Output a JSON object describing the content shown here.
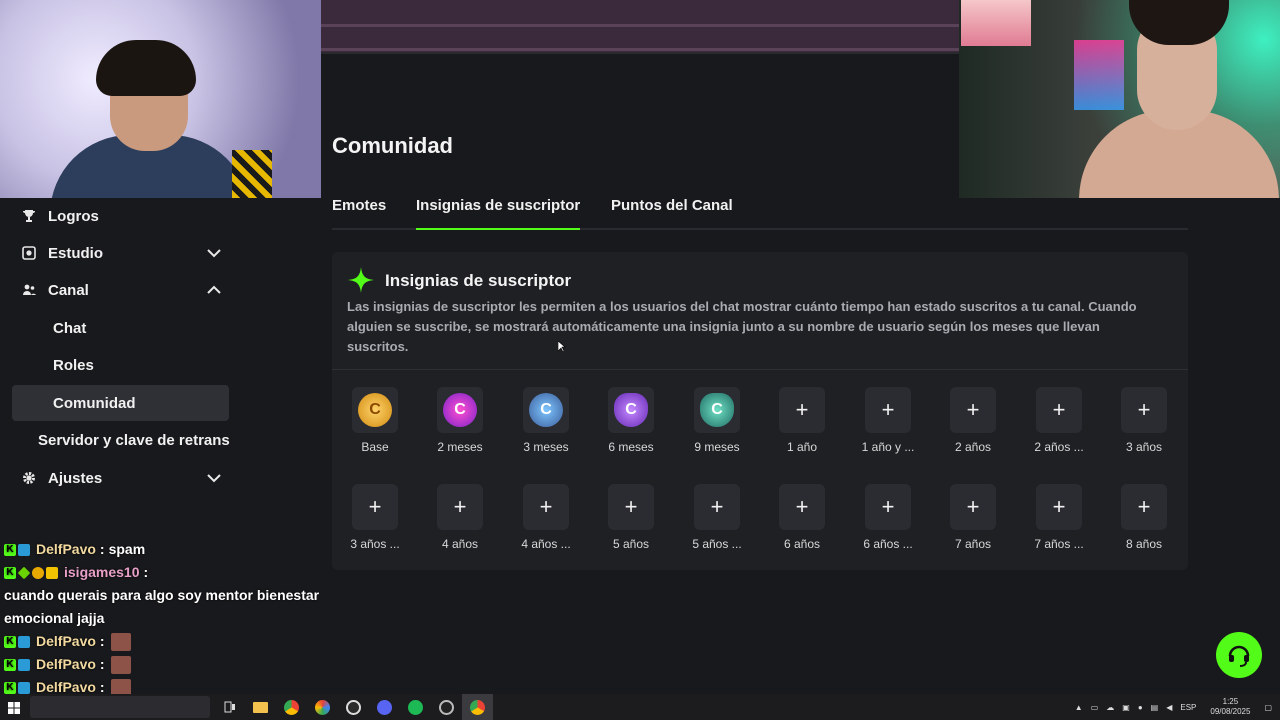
{
  "sidebar": {
    "items": [
      {
        "label": "Logros",
        "icon": "trophy-icon"
      },
      {
        "label": "Estudio",
        "icon": "studio-icon",
        "chevron": "down"
      },
      {
        "label": "Canal",
        "icon": "channel-icon",
        "chevron": "up"
      },
      {
        "label": "Chat"
      },
      {
        "label": "Roles"
      },
      {
        "label": "Comunidad"
      },
      {
        "label": "Servidor y clave de retrans"
      },
      {
        "label": "Ajustes",
        "icon": "gear-icon",
        "chevron": "down"
      }
    ]
  },
  "chat": {
    "messages": [
      {
        "user": "DelfPavo",
        "sep": ":",
        "text": "spam"
      },
      {
        "user": "isigames10",
        "sep": ":",
        "text": "cuando querais para algo soy mentor bienestar emocional jajja"
      },
      {
        "user": "DelfPavo",
        "sep": ":",
        "text": ""
      },
      {
        "user": "DelfPavo",
        "sep": ":",
        "text": ""
      },
      {
        "user": "DelfPavo",
        "sep": ":",
        "text": ""
      }
    ]
  },
  "page": {
    "title": "Comunidad",
    "tabs": [
      {
        "label": "Emotes",
        "active": false
      },
      {
        "label": "Insignias de suscriptor",
        "active": true
      },
      {
        "label": "Puntos del Canal",
        "active": false
      }
    ]
  },
  "card": {
    "title": "Insignias de suscriptor",
    "description": "Las insignias de suscriptor les permiten a los usuarios del chat mostrar cuánto tiempo han estado suscritos a tu canal. Cuando alguien se suscribe, se mostrará automáticamente una insignia junto a su nombre de usuario según los meses que llevan suscritos.",
    "badges_row1": [
      {
        "label": "Base",
        "type": "medal",
        "style": "m-base",
        "glyph": "C"
      },
      {
        "label": "2 meses",
        "type": "medal",
        "style": "m-2",
        "glyph": "C"
      },
      {
        "label": "3 meses",
        "type": "medal",
        "style": "m-3",
        "glyph": "C"
      },
      {
        "label": "6 meses",
        "type": "medal",
        "style": "m-6",
        "glyph": "C"
      },
      {
        "label": "9 meses",
        "type": "medal",
        "style": "m-9",
        "glyph": "C"
      },
      {
        "label": "1 año",
        "type": "add"
      },
      {
        "label": "1 año y ...",
        "type": "add"
      },
      {
        "label": "2 años",
        "type": "add"
      },
      {
        "label": "2 años ...",
        "type": "add"
      },
      {
        "label": "3 años",
        "type": "add"
      }
    ],
    "badges_row2": [
      {
        "label": "3 años ...",
        "type": "add"
      },
      {
        "label": "4 años",
        "type": "add"
      },
      {
        "label": "4 años ...",
        "type": "add"
      },
      {
        "label": "5 años",
        "type": "add"
      },
      {
        "label": "5 años ...",
        "type": "add"
      },
      {
        "label": "6 años",
        "type": "add"
      },
      {
        "label": "6 años ...",
        "type": "add"
      },
      {
        "label": "7 años",
        "type": "add"
      },
      {
        "label": "7 años ...",
        "type": "add"
      },
      {
        "label": "8 años",
        "type": "add"
      }
    ],
    "add_glyph": "+"
  },
  "taskbar": {
    "tray_lang": "ESP",
    "time": "1:25",
    "date": "09/08/2025"
  },
  "colors": {
    "accent": "#53fc18",
    "background": "#18191c",
    "card": "#1e2024",
    "slot": "#2a2c31"
  }
}
